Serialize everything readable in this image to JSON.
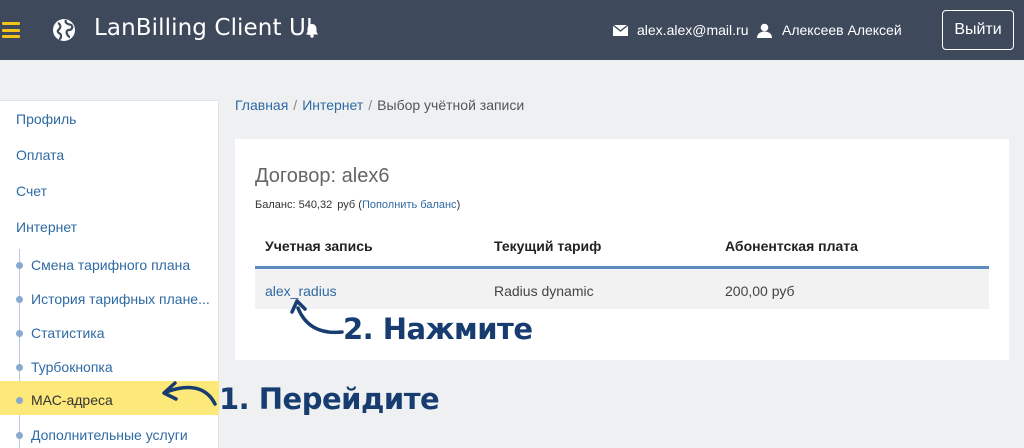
{
  "header": {
    "menu_icon": "hamburger-icon",
    "logo_icon": "globe-icon",
    "title": "LanBilling Client UI",
    "notification_icon": "bell-icon",
    "email_icon": "envelope-icon",
    "email": "alex.alex@mail.ru",
    "user_icon": "user-icon",
    "user_name": "Алексеев Алексей",
    "logout_label": "Выйти",
    "background": "#3e4a5c",
    "menu_color": "#f0c419"
  },
  "sidebar": {
    "items": [
      "Профиль",
      "Оплата",
      "Счет",
      "Интернет"
    ],
    "sub_items": [
      "Смена тарифного плана",
      "История тарифных плане...",
      "Статистика",
      "Турбокнопка",
      "МАС-адреса",
      "Дополнительные услуги"
    ],
    "active_sub_item": "МАС-адреса",
    "active_color": "#fde87a"
  },
  "breadcrumb": {
    "home": "Главная",
    "section": "Интернет",
    "current": "Выбор учётной записи",
    "separator": "/"
  },
  "contract": {
    "title": "Договор: alex6",
    "balance_label": "Баланс:",
    "balance_value": "540,32",
    "balance_currency": "руб",
    "topup_open": "(",
    "topup_link": "Пополнить баланс",
    "topup_close": ")"
  },
  "table": {
    "headers": [
      "Учетная запись",
      "Текущий тариф",
      "Абонентская плата"
    ],
    "rows": [
      {
        "account": "alex_radius",
        "tariff": "Radius dynamic",
        "fee": "200,00 руб"
      }
    ]
  },
  "annotations": {
    "step1": "1. Перейдите",
    "step2": "2. Нажмите",
    "color": "#173d70"
  }
}
